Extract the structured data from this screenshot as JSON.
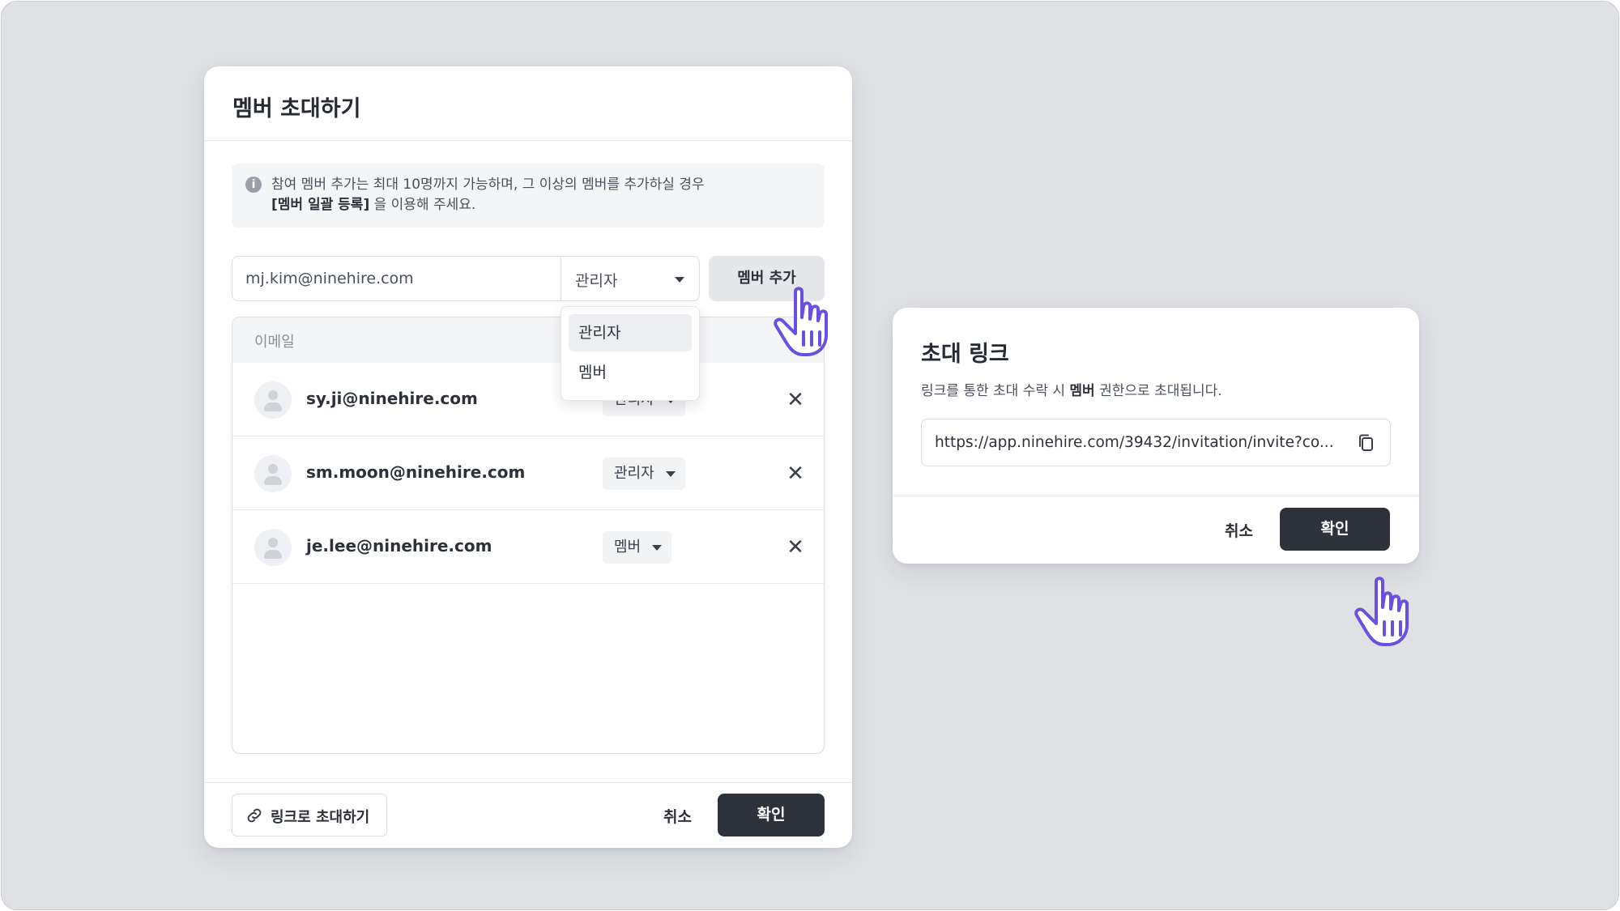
{
  "invite_modal": {
    "title": "멤버 초대하기",
    "notice_line1": "참여 멤버 추가는 최대 10명까지 가능하며, 그 이상의 멤버를 추가하실 경우",
    "notice_bold": "[멤버 일괄 등록]",
    "notice_line2_rest": " 을 이용해 주세요.",
    "email_value": "mj.kim@ninehire.com",
    "role_selected": "관리자",
    "add_button": "멤버 추가",
    "dropdown_options": [
      "관리자",
      "멤버"
    ],
    "list_header": "이메일",
    "members": [
      {
        "email": "sy.ji@ninehire.com",
        "role": "관리자"
      },
      {
        "email": "sm.moon@ninehire.com",
        "role": "관리자"
      },
      {
        "email": "je.lee@ninehire.com",
        "role": "멤버"
      }
    ],
    "link_invite_button": "링크로 초대하기",
    "cancel_button": "취소",
    "confirm_button": "확인"
  },
  "link_modal": {
    "title": "초대 링크",
    "desc_before": "링크를 통한 초대 수락 시 ",
    "desc_bold": "멤버",
    "desc_after": " 권한으로 초대됩니다.",
    "url": "https://app.ninehire.com/39432/invitation/invite?co...",
    "cancel_button": "취소",
    "confirm_button": "확인"
  },
  "colors": {
    "background": "#dfe1e5",
    "dark_button": "#2e323b",
    "cursor_accent": "#6a4fe0"
  },
  "icons": [
    "info-icon",
    "chevron-down-icon",
    "close-icon",
    "link-icon",
    "copy-icon",
    "avatar-icon",
    "hand-pointer-icon"
  ]
}
